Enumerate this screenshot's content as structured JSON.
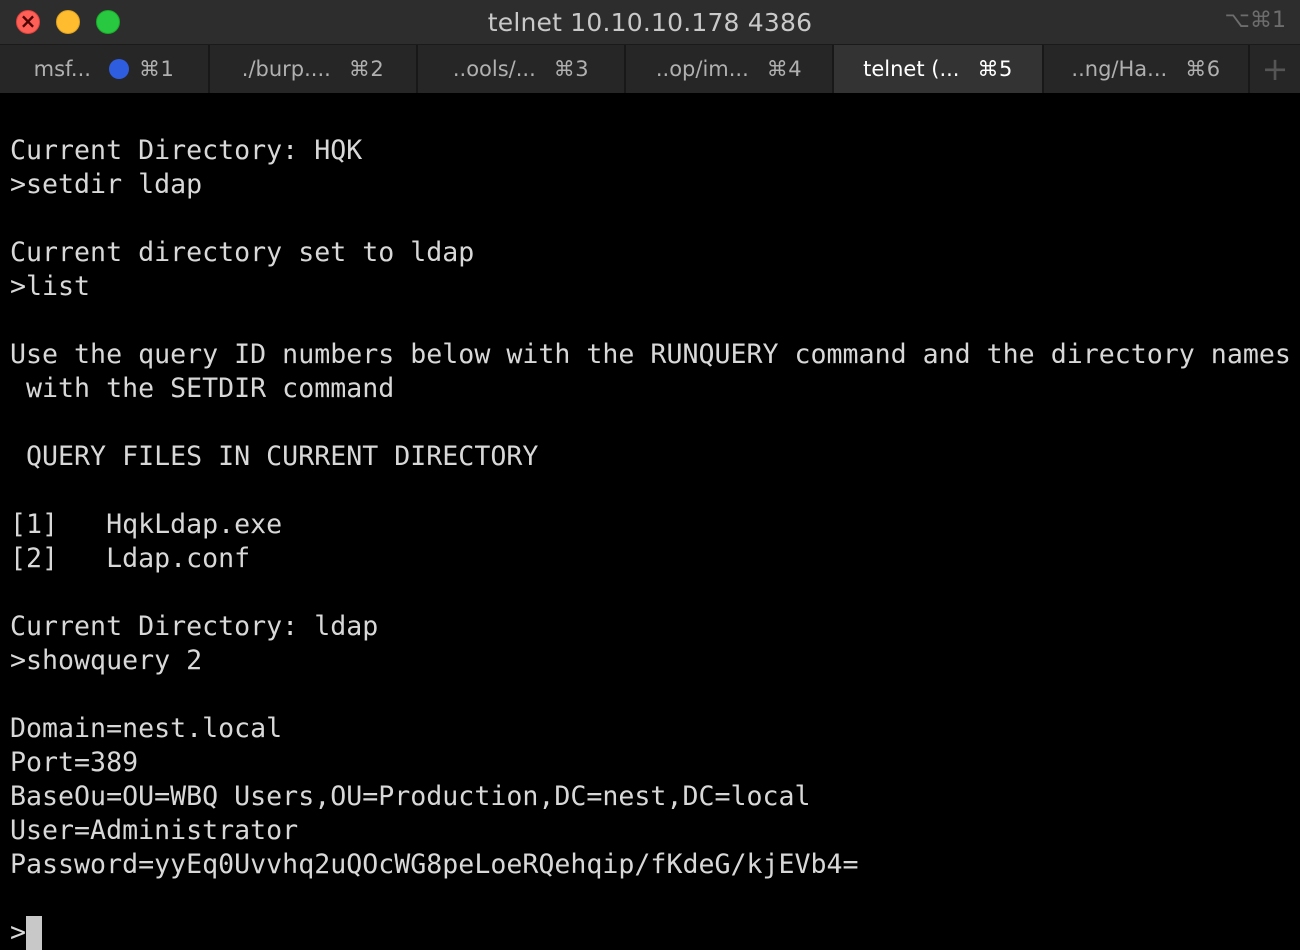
{
  "window": {
    "title": "telnet 10.10.10.178 4386",
    "shortcut": "⌥⌘1"
  },
  "tabs": [
    {
      "label": "msf...",
      "key": "⌘1",
      "active": false,
      "activity_dot": true
    },
    {
      "label": "./burp....",
      "key": "⌘2",
      "active": false
    },
    {
      "label": "..ools/...",
      "key": "⌘3",
      "active": false
    },
    {
      "label": "..op/im...",
      "key": "⌘4",
      "active": false
    },
    {
      "label": "telnet (...",
      "key": "⌘5",
      "active": true
    },
    {
      "label": "..ng/Ha...",
      "key": "⌘6",
      "active": false
    }
  ],
  "new_tab_icon": "plus-icon",
  "terminal": {
    "lines": [
      "",
      "Current Directory: HQK",
      ">setdir ldap",
      "",
      "Current directory set to ldap",
      ">list",
      "",
      "Use the query ID numbers below with the RUNQUERY command and the directory names",
      " with the SETDIR command",
      "",
      " QUERY FILES IN CURRENT DIRECTORY",
      "",
      "[1]   HqkLdap.exe",
      "[2]   Ldap.conf",
      "",
      "Current Directory: ldap",
      ">showquery 2",
      "",
      "Domain=nest.local",
      "Port=389",
      "BaseOu=OU=WBQ Users,OU=Production,DC=nest,DC=local",
      "User=Administrator",
      "Password=yyEq0Uvvhq2uQOcWG8peLoeRQehqip/fKdeG/kjEVb4=",
      ""
    ],
    "prompt": ">"
  },
  "colors": {
    "titlebar": "#2d2d2d",
    "tab_active": "#333333",
    "terminal_bg": "#000000",
    "terminal_fg": "#d8d8d8",
    "activity_dot": "#2f5de0"
  }
}
